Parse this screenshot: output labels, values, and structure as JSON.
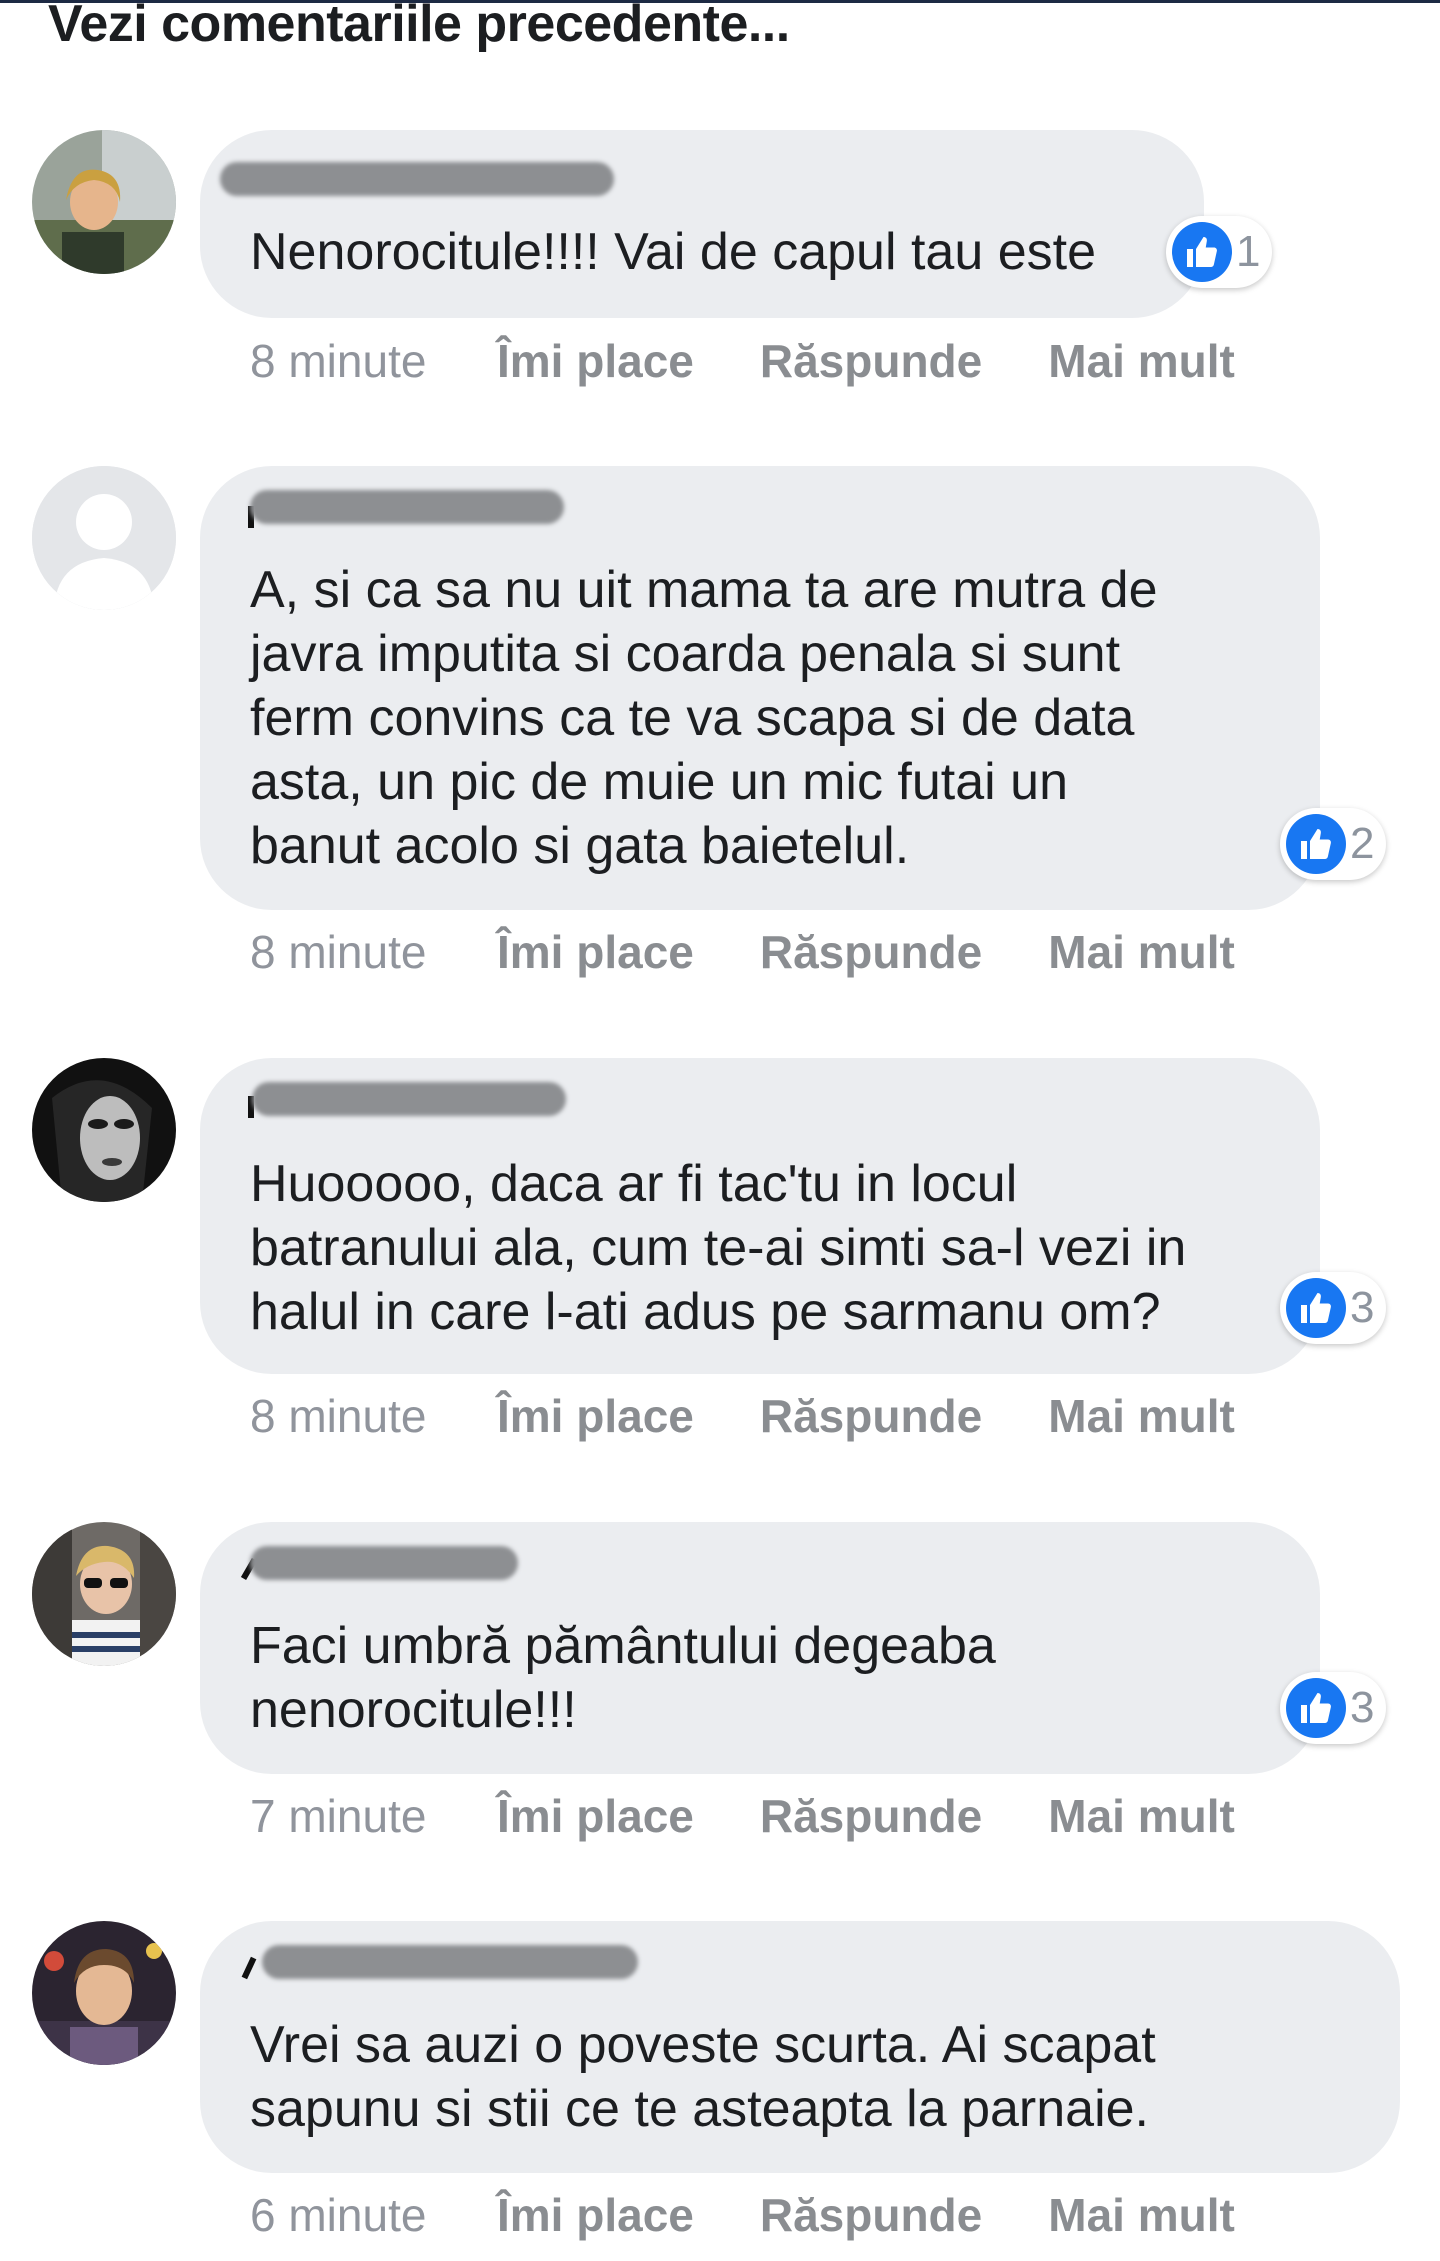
{
  "header": {
    "view_previous": "Vezi comentariile precedente..."
  },
  "actions": {
    "like": "Îmi place",
    "reply": "Răspunde",
    "more": "Mai mult"
  },
  "colors": {
    "like_blue": "#1877f2",
    "bubble": "#ebedf0"
  },
  "comments": [
    {
      "text_lines": [
        "Nenorocitule!!!! Vai de capul tau este"
      ],
      "reactions": "1",
      "time": "8 minute",
      "avatar": "woman-photo-avatar"
    },
    {
      "text_lines": [
        "A, si ca sa nu uit mama ta are mutra de",
        "javra imputita si coarda penala si sunt",
        "ferm convins ca te va scapa si de data",
        "asta, un pic de muie un mic futai un",
        "banut acolo si gata baietelul."
      ],
      "reactions": "2",
      "time": "8 minute",
      "avatar": "default-silhouette-avatar"
    },
    {
      "text_lines": [
        "Huooooo, daca ar fi tac'tu in locul",
        "batranului ala, cum te-ai simti sa-l vezi in",
        "halul in care l-ati adus pe sarmanu om?"
      ],
      "reactions": "3",
      "time": "8 minute",
      "avatar": "dark-portrait-avatar"
    },
    {
      "text_lines": [
        "Faci umbră pământului degeaba",
        "nenorocitule!!!"
      ],
      "reactions": "3",
      "time": "7 minute",
      "avatar": "woman-sunglasses-avatar"
    },
    {
      "text_lines": [
        "Vrei sa auzi o poveste scurta. Ai scapat",
        "sapunu si stii ce te asteapta la parnaie."
      ],
      "reactions": "",
      "time": "6 minute",
      "avatar": "man-photo-avatar"
    }
  ]
}
